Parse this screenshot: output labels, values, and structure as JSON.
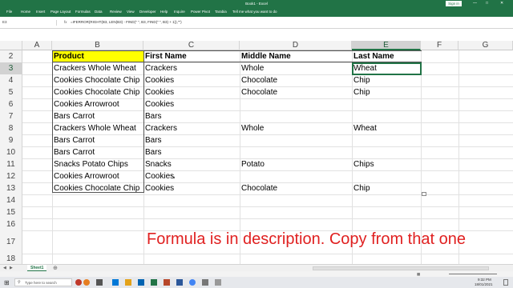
{
  "window": {
    "title": "Book1 - Excel",
    "signin": "Sign in"
  },
  "ribbon": {
    "tabs": [
      "File",
      "Home",
      "Insert",
      "Page Layout",
      "Formulas",
      "Data",
      "Review",
      "View",
      "Developer",
      "Help",
      "Inquire",
      "Power Pivot",
      "Tarabia"
    ],
    "tell_me": "Tell me what you want to do"
  },
  "formula_bar": {
    "name_box": "E3",
    "fx": "fx",
    "formula": "=IFERROR(RIGHT(B3, LEN(B3) - FIND(\" \", B3, FIND(\" \", B3) + 1)),\"\")"
  },
  "columns": [
    "A",
    "B",
    "C",
    "D",
    "E",
    "F",
    "G"
  ],
  "rows": [
    "2",
    "3",
    "4",
    "5",
    "6",
    "7",
    "8",
    "9",
    "10",
    "11",
    "12",
    "13",
    "14",
    "15",
    "16",
    "17",
    "18"
  ],
  "table": {
    "headers": [
      "Product",
      "First Name",
      "Middle Name",
      "Last Name"
    ],
    "rows": [
      [
        "Crackers Whole Wheat",
        "Crackers",
        "Whole",
        "Wheat"
      ],
      [
        "Cookies Chocolate Chip",
        "Cookies",
        "Chocolate",
        "Chip"
      ],
      [
        "Cookies Chocolate Chip",
        "Cookies",
        "Chocolate",
        "Chip"
      ],
      [
        "Cookies Arrowroot",
        "Cookies",
        "",
        ""
      ],
      [
        "Bars Carrot",
        "Bars",
        "",
        ""
      ],
      [
        "Crackers Whole Wheat",
        "Crackers",
        "Whole",
        "Wheat"
      ],
      [
        "Bars Carrot",
        "Bars",
        "",
        ""
      ],
      [
        "Bars Carrot",
        "Bars",
        "",
        ""
      ],
      [
        "Snacks Potato Chips",
        "Snacks",
        "Potato",
        "Chips"
      ],
      [
        "Cookies Arrowroot",
        "Cookies",
        "",
        ""
      ],
      [
        "Cookies Chocolate Chip",
        "Cookies",
        "Chocolate",
        "Chip"
      ]
    ]
  },
  "caption": "Formula is in description. Copy from that one",
  "sheet_tab": "Sheet1",
  "taskbar": {
    "search": "Type here to search",
    "time": "9:32 PM",
    "date": "18/01/2021"
  },
  "colors": {
    "excel_green": "#217346",
    "header_yellow": "#ffff00",
    "caption_red": "#e02020"
  }
}
